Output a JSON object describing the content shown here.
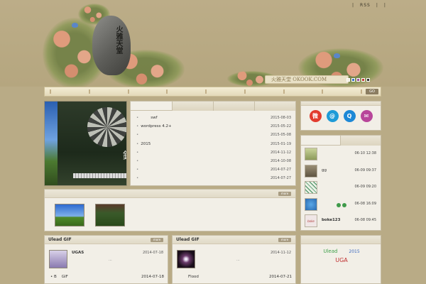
{
  "header": {
    "rock_text": "火雅天堂",
    "logo_text": "火雅天堂 OKOOK.COM",
    "top_links": [
      "|",
      "RSS",
      "|",
      "|"
    ],
    "swatch_colors": [
      "#f3eee0",
      "#3b6fc2",
      "#9a4f9c",
      "#c43a3a",
      "#333333"
    ],
    "go_label": "GO"
  },
  "slideshow": {
    "char": "錯"
  },
  "posts": {
    "items": [
      {
        "title": "swf",
        "date": "2015-08-03"
      },
      {
        "title": "wordpress 4.2+",
        "date": "2015-05-22"
      },
      {
        "title": "",
        "date": "2015-05-08"
      },
      {
        "title": "2015",
        "date": "2015-01-19"
      },
      {
        "title": "",
        "date": "2014-11-12"
      },
      {
        "title": "",
        "date": "2014-10-08"
      },
      {
        "title": "",
        "date": "2014-07-27"
      },
      {
        "title": "",
        "date": "2014-07-27"
      }
    ]
  },
  "social": {
    "icons": [
      {
        "name": "weibo-icon",
        "glyph": "微",
        "color": "#e23b2e"
      },
      {
        "name": "tencent-weibo-icon",
        "glyph": "@",
        "color": "#1e9bd7"
      },
      {
        "name": "qq-icon",
        "glyph": "Q",
        "color": "#1d88d6"
      },
      {
        "name": "mail-icon",
        "glyph": "✉",
        "color": "#b8469a"
      }
    ]
  },
  "comments": {
    "items": [
      {
        "name": "",
        "time": "06-10 12:38",
        "avatar": "#a8b07a"
      },
      {
        "name": "gg",
        "time": "06-09 09:37",
        "avatar": "#7b6f58"
      },
      {
        "name": "",
        "time": "06-09 09:20",
        "avatar": "#e8f0e4"
      },
      {
        "name": "",
        "time": "06-08 16:09",
        "avatar": "#2a8ad0"
      },
      {
        "name": "boke123",
        "time": "06-08 09:45",
        "avatar": "#f0e6e6"
      }
    ]
  },
  "ulead1": {
    "title": "Ulead GIF",
    "item_name": "UGAS",
    "item_date": "2014-07-18",
    "dots": "...",
    "line2_left": "B",
    "line2_mid": "GIF",
    "line2_date": "2014-07-18"
  },
  "ulead2": {
    "title": "Ulead GIF",
    "item_date": "2014-11-12",
    "dots": "...",
    "line2_mid": "Flood",
    "line2_date": "2014-07-21"
  },
  "tags": [
    {
      "text": "Ulead",
      "color": "#3fa04a"
    },
    {
      "text": "2015",
      "color": "#3a68c0"
    },
    {
      "text": "UGA",
      "color": "#c03030"
    }
  ],
  "more_label": "more"
}
